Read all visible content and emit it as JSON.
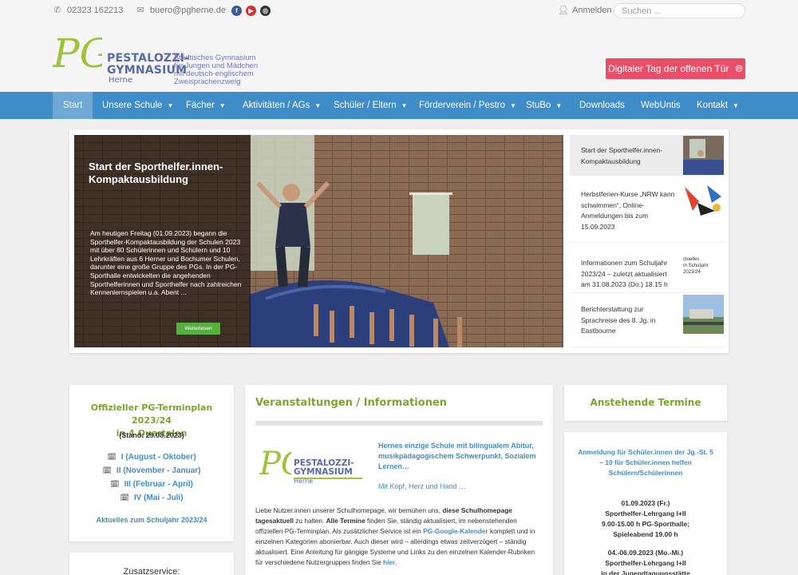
{
  "topbar": {
    "phone": "02323 162213",
    "email": "buero@pgherne.de",
    "login": "Anmelden",
    "search_placeholder": "Suchen ...",
    "social": [
      {
        "name": "facebook-icon",
        "color": "#3b5998",
        "glyph": "f"
      },
      {
        "name": "youtube-icon",
        "color": "#d62d2d",
        "glyph": "▶"
      },
      {
        "name": "instagram-icon",
        "color": "#333333",
        "glyph": "◎"
      }
    ]
  },
  "logo": {
    "initials": "PG",
    "name_line1": "PESTALOZZI-",
    "name_line2": "GYMNASIUM",
    "city": "Herne",
    "subtitle": [
      "Städtisches Gymnasium",
      "für Jungen und Mädchen",
      "mit deutsch-englischem",
      "Zweisprachenzweig"
    ]
  },
  "cta": {
    "label": "Digitaler Tag der offenen Tür",
    "icon": "globe-icon"
  },
  "nav": [
    {
      "label": "Start",
      "active": true,
      "dropdown": false
    },
    {
      "label": "Unsere Schule",
      "dropdown": true
    },
    {
      "label": "Fächer",
      "dropdown": true
    },
    {
      "label": "Aktivitäten / AGs",
      "dropdown": true
    },
    {
      "label": "Schüler / Eltern",
      "dropdown": true
    },
    {
      "label": "Förderverein / Pestro",
      "dropdown": true
    },
    {
      "label": "StuBo",
      "dropdown": true
    },
    {
      "label": "Downloads",
      "dropdown": false
    },
    {
      "label": "WebUntis",
      "dropdown": false
    },
    {
      "label": "Kontakt",
      "dropdown": true
    }
  ],
  "slider": {
    "title": "Start der Sporthelfer.innen-Kompaktausbildung",
    "text": "Am heutigen Freitag (01.09.2023) begann die Sporthelfer-Kompaktausbildung der Schulen 2023 mit über 80 Schülerinnen und Schülern und 10 Lehrkräften aus 6 Herner und Bochumer Schulen, darunter eine große Gruppe des PGs. In der PG-Sporthalle entwickelten die angehenden Sporthelferinnen und Sporthelfer nach zahlreichen Kennenlernspielen u.a. Abent ...",
    "button": "Weiterlesen",
    "items": [
      {
        "text": "Start der Sporthelfer.innen-Kompaktausbildung",
        "active": true
      },
      {
        "text": "Herbstferien-Kurse „NRW kann schwimmen“, Online-Anmeldungen bis zum 15.09.2023",
        "active": false
      },
      {
        "text": "Informationen zum Schuljahr 2023/24 – zuletzt aktualisiert am 31.08.2023 (Do.) 18.15 h",
        "active": false,
        "thumb_text": [
          "ctuelles",
          "m Schuljahr 2023/24"
        ]
      },
      {
        "text": "Berichterstattung zur Sprachreise des 8. Jg. in Eastbourne",
        "active": false
      }
    ]
  },
  "terminplan": {
    "title_line1": "Offizieller PG-Terminplan 2023/24",
    "title_line2": "in 4 Quartalen",
    "stand": "(Stand: 29.08.2023)",
    "quarters": [
      "I (August - Oktober)",
      "II (November - Januar)",
      "III (Februar - April)",
      "IV (Mai - Juli)"
    ],
    "aktuelles": "Aktuelles zum Schuljahr 2023/24"
  },
  "zusatz": {
    "title": "Zusatzservice:"
  },
  "veranstaltungen": {
    "title": "Veranstaltungen / Informationen",
    "promo_link": "Hernes einzige Schule mit bilingualem Abitur, musikpädagogischem Schwerpunkt, Sozialem Lernen…",
    "promo_tagline": "Mit Kopf, Herz und Hand …",
    "body_parts": [
      {
        "t": "Liebe Nutzer.innen unserer Schulhomepage, wir bemühen uns, ",
        "s": "n"
      },
      {
        "t": "diese Schulhomepage tagesaktuell",
        "s": "b"
      },
      {
        "t": " zu halten. ",
        "s": "n"
      },
      {
        "t": "Alle Termine",
        "s": "b"
      },
      {
        "t": " finden Sie, ständig aktualisiert, im nebenstehenden offiziellen PG-Terminplan. Als zusätzlicher Service ist ein ",
        "s": "n"
      },
      {
        "t": "PG-Google-Kalender",
        "s": "l"
      },
      {
        "t": " komplett und in einzelnen Kategorien abonierbar. Auch dieser wird – allerdings etwas zeitverzögert – ständig aktualisiert.  Eine Anleitung für gängige Systeme und Links zu den einzelnen Kalender-Rubriken für verschiedene Nutzergruppen finden Sie ",
        "s": "n"
      },
      {
        "t": "hier",
        "s": "l"
      },
      {
        "t": ".",
        "s": "n"
      }
    ]
  },
  "anstehende": {
    "title": "Anstehende Termine",
    "announcement": "Anmeldung für Schüler.innen der Jg.-St. 5 – 10 für Schüler.innen helfen Schülern/Schülerinnen",
    "entries": [
      {
        "date": "01.09.2023 (Fr.)",
        "lines": [
          "Sporthelfer-Lehrgang I+II",
          "9.00-15.00 h PG-Sporthalle;",
          "Spieleabend 19.00 h"
        ]
      },
      {
        "date": "04.-06.09.2023 (Mo.-Mi.)",
        "lines": [
          "Sporthelfer-Lehrgang I+II",
          "in der Jugendtagungsstätte"
        ]
      }
    ]
  },
  "colors": {
    "nav": "#3f8dc8",
    "accent_green": "#7aa62c",
    "cta": "#e94e68",
    "logo_blue": "#5a6aa8",
    "logo_green": "#9ec23a"
  }
}
